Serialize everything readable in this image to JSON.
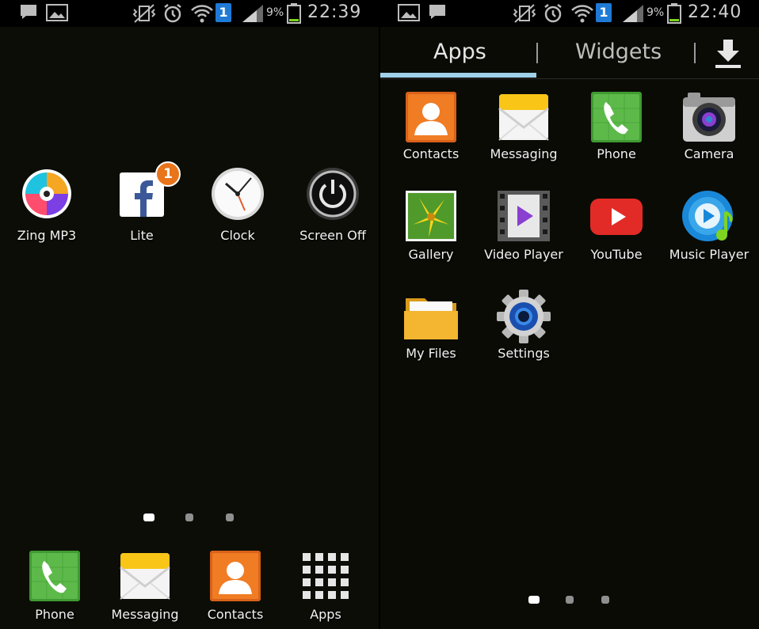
{
  "home": {
    "status": {
      "battery_pct": "9%",
      "time": "22:39",
      "sim_slot": "1"
    },
    "apps": [
      {
        "label": "Zing MP3",
        "icon": "zing-mp3-icon"
      },
      {
        "label": "Lite",
        "icon": "facebook-lite-icon",
        "badge": "1"
      },
      {
        "label": "Clock",
        "icon": "clock-icon"
      },
      {
        "label": "Screen Off",
        "icon": "power-icon"
      }
    ],
    "dock": [
      {
        "label": "Phone",
        "icon": "phone-icon"
      },
      {
        "label": "Messaging",
        "icon": "messaging-icon"
      },
      {
        "label": "Contacts",
        "icon": "contacts-icon"
      },
      {
        "label": "Apps",
        "icon": "app-grid-icon"
      }
    ],
    "page_count": 3,
    "active_page": 1
  },
  "drawer": {
    "status": {
      "battery_pct": "9%",
      "time": "22:40",
      "sim_slot": "1"
    },
    "tabs": {
      "apps": "Apps",
      "widgets": "Widgets"
    },
    "apps": [
      {
        "label": "Contacts",
        "icon": "contacts-icon"
      },
      {
        "label": "Messaging",
        "icon": "messaging-icon"
      },
      {
        "label": "Phone",
        "icon": "phone-icon"
      },
      {
        "label": "Camera",
        "icon": "camera-icon"
      },
      {
        "label": "Gallery",
        "icon": "gallery-icon"
      },
      {
        "label": "Video Player",
        "icon": "video-player-icon"
      },
      {
        "label": "YouTube",
        "icon": "youtube-icon"
      },
      {
        "label": "Music Player",
        "icon": "music-player-icon"
      },
      {
        "label": "My Files",
        "icon": "folder-icon"
      },
      {
        "label": "Settings",
        "icon": "settings-gear-icon"
      }
    ],
    "page_count": 3,
    "active_page": 1
  },
  "colors": {
    "tab_indicator": "#9fd0ea",
    "battery_level": "#7ed321",
    "sim_badge": "#1f7ad6"
  }
}
